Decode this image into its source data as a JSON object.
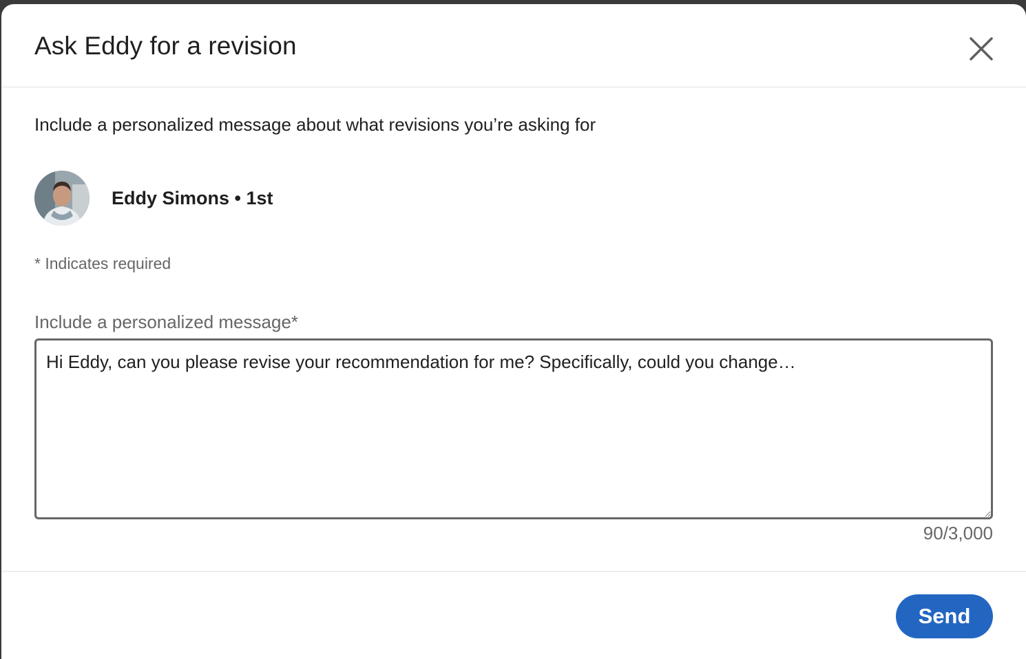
{
  "modal": {
    "title": "Ask Eddy for a revision",
    "close_icon": "close-icon",
    "intro": "Include a personalized message about what revisions you’re asking for",
    "person": {
      "name": "Eddy Simons • 1st",
      "avatar_icon": "avatar"
    },
    "required_note": "* Indicates required",
    "message_field": {
      "label": "Include a personalized message*",
      "value": "Hi Eddy, can you please revise your recommendation for me? Specifically, could you change…",
      "counter": "90/3,000"
    },
    "send_label": "Send"
  },
  "colors": {
    "accent": "#2366c2",
    "text": "#1f1f1f",
    "muted": "#666666"
  }
}
